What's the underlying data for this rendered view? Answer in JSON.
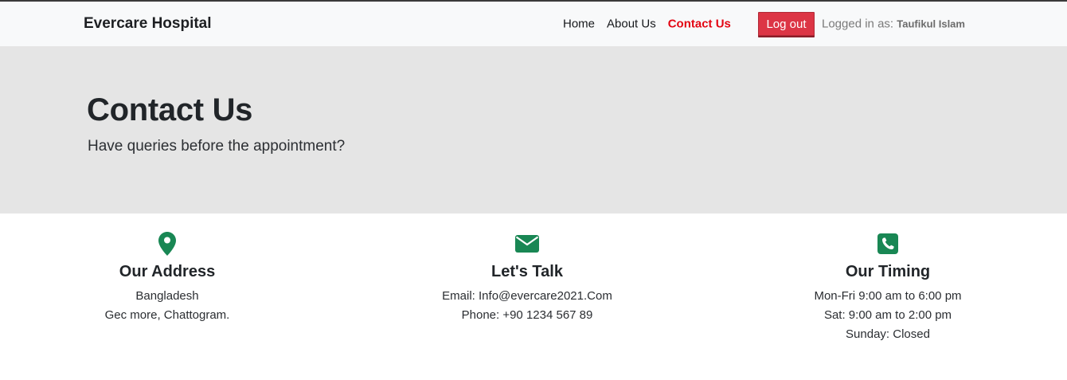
{
  "navbar": {
    "brand": "Evercare Hospital",
    "links": [
      {
        "label": "Home",
        "active": false
      },
      {
        "label": "About Us",
        "active": false
      },
      {
        "label": "Contact Us",
        "active": true
      }
    ],
    "logout_label": "Log out",
    "logged_in_prefix": "Logged in as:",
    "username": "Taufikul Islam"
  },
  "hero": {
    "title": "Contact Us",
    "subtitle": "Have queries before the appointment?"
  },
  "info": {
    "address": {
      "icon": "map-pin-icon",
      "title": "Our Address",
      "lines": [
        "Bangladesh",
        "Gec more, Chattogram."
      ]
    },
    "talk": {
      "icon": "envelope-icon",
      "title": "Let's Talk",
      "lines": [
        "Email: Info@evercare2021.Com",
        "Phone: +90 1234 567 89"
      ]
    },
    "timing": {
      "icon": "phone-square-icon",
      "title": "Our Timing",
      "lines": [
        "Mon-Fri 9:00 am to 6:00 pm",
        "Sat: 9:00 am to 2:00 pm",
        "Sunday: Closed"
      ]
    }
  },
  "colors": {
    "accent_green": "#198754",
    "active_link": "#e30613",
    "logout_bg": "#dc3545"
  }
}
